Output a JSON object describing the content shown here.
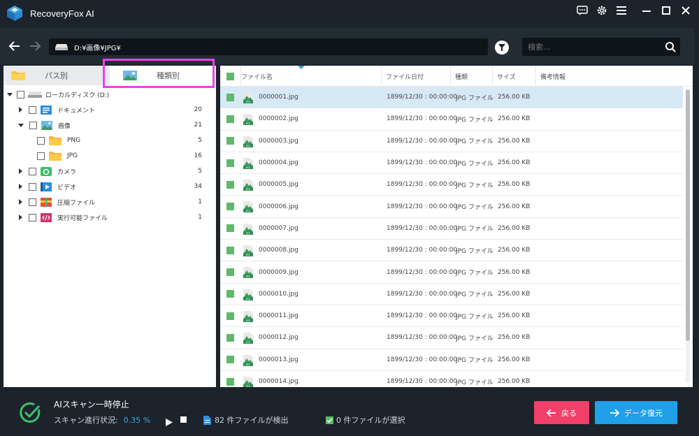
{
  "app": {
    "title": "RecoveryFox AI"
  },
  "toolbar": {
    "path": "D:¥画像¥JPG¥",
    "search_placeholder": "検索..."
  },
  "tabs": [
    {
      "label": "パス別",
      "active": false
    },
    {
      "label": "種類別",
      "active": true
    }
  ],
  "tree": [
    {
      "label": "ローカルディスク (D:)",
      "count": "",
      "level": 0,
      "expanded": true,
      "icon": "drive-icon"
    },
    {
      "label": "ドキュメント",
      "count": "20",
      "level": 1,
      "expanded": false,
      "icon": "document-icon"
    },
    {
      "label": "画像",
      "count": "21",
      "level": 1,
      "expanded": true,
      "icon": "image-icon"
    },
    {
      "label": "PNG",
      "count": "5",
      "level": 2,
      "expanded": false,
      "icon": "folder-icon"
    },
    {
      "label": "JPG",
      "count": "16",
      "level": 2,
      "expanded": false,
      "icon": "folder-icon"
    },
    {
      "label": "カメラ",
      "count": "5",
      "level": 1,
      "expanded": false,
      "icon": "camera-icon"
    },
    {
      "label": "ビデオ",
      "count": "34",
      "level": 1,
      "expanded": false,
      "icon": "video-icon"
    },
    {
      "label": "圧縮ファイル",
      "count": "1",
      "level": 1,
      "expanded": false,
      "icon": "archive-icon"
    },
    {
      "label": "実行可能ファイル",
      "count": "1",
      "level": 1,
      "expanded": false,
      "icon": "executable-icon"
    }
  ],
  "table": {
    "columns": [
      "ファイル名",
      "ファイル日付",
      "種類",
      "サイズ",
      "備考情報"
    ],
    "rows": [
      {
        "name": "0000001.jpg",
        "date": "1899/12/30 : 00:00:00",
        "type": "JPG ファイル",
        "size": "256.00 KB"
      },
      {
        "name": "0000002.jpg",
        "date": "1899/12/30 : 00:00:00",
        "type": "JPG ファイル",
        "size": "256.00 KB"
      },
      {
        "name": "0000003.jpg",
        "date": "1899/12/30 : 00:00:00",
        "type": "JPG ファイル",
        "size": "256.00 KB"
      },
      {
        "name": "0000004.jpg",
        "date": "1899/12/30 : 00:00:00",
        "type": "JPG ファイル",
        "size": "256.00 KB"
      },
      {
        "name": "0000005.jpg",
        "date": "1899/12/30 : 00:00:00",
        "type": "JPG ファイル",
        "size": "256.00 KB"
      },
      {
        "name": "0000006.jpg",
        "date": "1899/12/30 : 00:00:00",
        "type": "JPG ファイル",
        "size": "256.00 KB"
      },
      {
        "name": "0000007.jpg",
        "date": "1899/12/30 : 00:00:00",
        "type": "JPG ファイル",
        "size": "256.00 KB"
      },
      {
        "name": "0000008.jpg",
        "date": "1899/12/30 : 00:00:00",
        "type": "JPG ファイル",
        "size": "256.00 KB"
      },
      {
        "name": "0000009.jpg",
        "date": "1899/12/30 : 00:00:00",
        "type": "JPG ファイル",
        "size": "256.00 KB"
      },
      {
        "name": "0000010.jpg",
        "date": "1899/12/30 : 00:00:00",
        "type": "JPG ファイル",
        "size": "256.00 KB"
      },
      {
        "name": "0000011.jpg",
        "date": "1899/12/30 : 00:00:00",
        "type": "JPG ファイル",
        "size": "256.00 KB"
      },
      {
        "name": "0000012.jpg",
        "date": "1899/12/30 : 00:00:00",
        "type": "JPG ファイル",
        "size": "256.00 KB"
      },
      {
        "name": "0000013.jpg",
        "date": "1899/12/30 : 00:00:00",
        "type": "JPG ファイル",
        "size": "256.00 KB"
      },
      {
        "name": "0000014.jpg",
        "date": "1899/12/30 : 00:00:00",
        "type": "JPG ファイル",
        "size": "256.00 KB"
      }
    ]
  },
  "footer": {
    "status_title": "AIスキャン一時停止",
    "progress_label": "スキャン進行状況:",
    "progress_value": "0.35 %",
    "found_text": "82 件ファイルが検出",
    "selected_text": "0 件ファイルが選択",
    "back_label": "戻る",
    "recover_label": "データ復元"
  },
  "colors": {
    "accent": "#1fa0e8",
    "back": "#f0406a",
    "highlight": "#f040ec",
    "check": "#5fb86b"
  }
}
